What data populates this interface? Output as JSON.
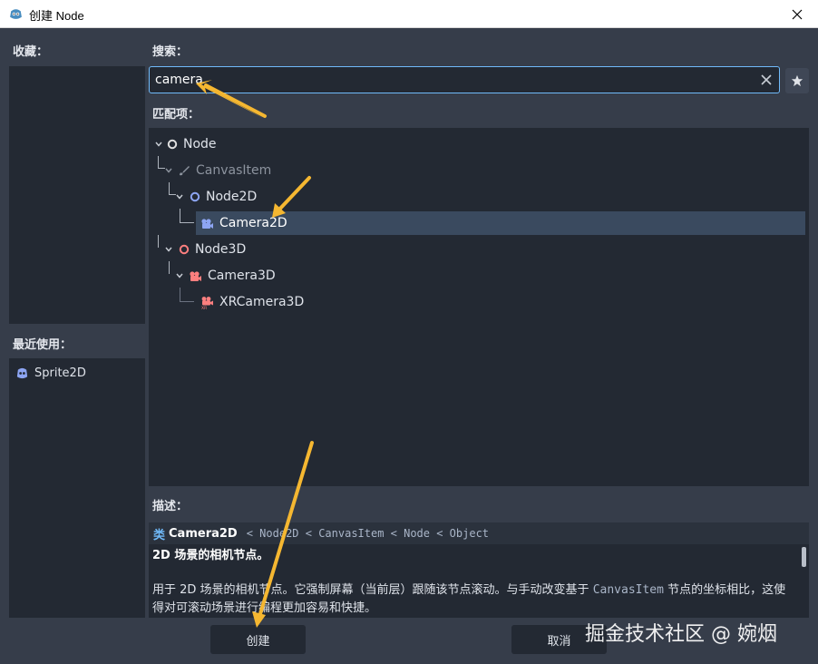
{
  "window": {
    "title": "创建 Node",
    "close_glyph": "✕"
  },
  "favorites": {
    "label": "收藏："
  },
  "recent": {
    "label": "最近使用：",
    "items": [
      {
        "label": "Sprite2D",
        "icon": "sprite2d-icon"
      }
    ]
  },
  "search": {
    "label": "搜索：",
    "value": "camera"
  },
  "matches": {
    "label": "匹配项：",
    "items": [
      {
        "label": "Node",
        "icon": "node-icon",
        "color": "#e0e0e0"
      },
      {
        "label": "CanvasItem",
        "icon": "canvasitem-icon",
        "color": "#8c939e"
      },
      {
        "label": "Node2D",
        "icon": "node2d-icon",
        "color": "#8da5f3"
      },
      {
        "label": "Camera2D",
        "icon": "camera2d-icon",
        "color": "#8da5f3"
      },
      {
        "label": "Node3D",
        "icon": "node3d-icon",
        "color": "#fc7f7f"
      },
      {
        "label": "Camera3D",
        "icon": "camera3d-icon",
        "color": "#fc7f7f"
      },
      {
        "label": "XRCamera3D",
        "icon": "xrcamera3d-icon",
        "color": "#fc7f7f"
      }
    ]
  },
  "description": {
    "label": "描述：",
    "keyword": "类",
    "class_name": "Camera2D",
    "inheritance": "< Node2D < CanvasItem < Node < Object",
    "brief": "2D 场景的相机节点。",
    "text_1": "用于 2D 场景的相机节点。它强制屏幕（当前层）跟随该节点滚动。与手动改变基于",
    "text_code": "CanvasItem",
    "text_2": "节点的坐标相比，这使得对可滚动场景进行编程更加容易和快捷。"
  },
  "buttons": {
    "create": "创建",
    "cancel": "取消"
  },
  "watermark": "掘金技术社区 @ 婉烟",
  "colors": {
    "accent": "#70bafa",
    "annotation_arrow": "#f5b731"
  }
}
